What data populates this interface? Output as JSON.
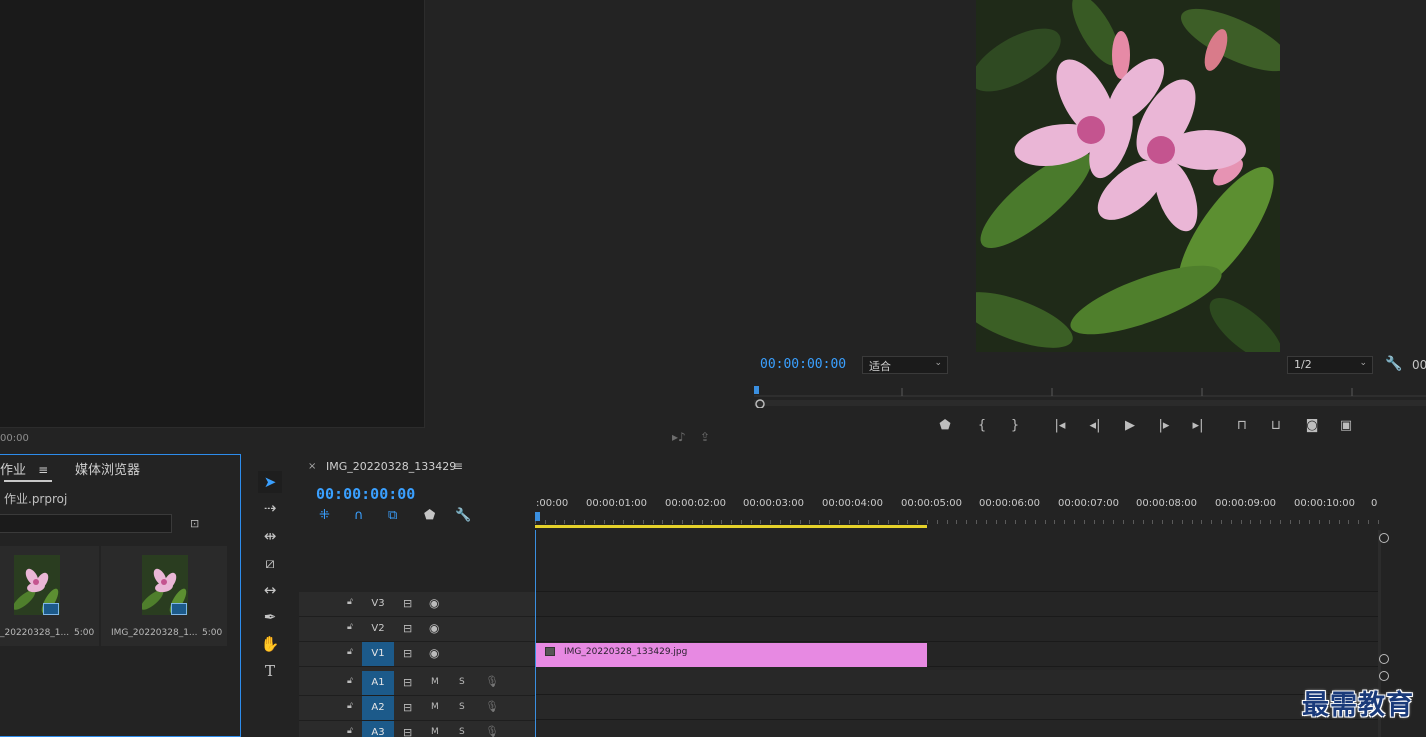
{
  "source_monitor": {
    "timecode_partial": "00:00",
    "icons": [
      "audio-only-icon",
      "export-icon"
    ]
  },
  "program_monitor": {
    "timecode": "00:00:00:00",
    "fit_dropdown": "适合",
    "resolution_dropdown": "1/2",
    "right_timecode_partial": "00",
    "controls": [
      "marker-icon",
      "mark-in-icon",
      "mark-out-icon",
      "go-to-in-icon",
      "step-back-icon",
      "play-icon",
      "step-forward-icon",
      "go-to-out-icon",
      "lift-icon",
      "extract-icon",
      "export-frame-icon",
      "compare-icon"
    ]
  },
  "project_panel": {
    "tab_active": "作业",
    "tab_other": "媒体浏览器",
    "project_file": "作业.prproj",
    "items": [
      {
        "name": "_20220328_1...",
        "duration": "5:00"
      },
      {
        "name": "IMG_20220328_1...",
        "duration": "5:00"
      }
    ]
  },
  "timeline": {
    "sequence_name": "IMG_20220328_133429",
    "timecode": "00:00:00:00",
    "ruler_labels": [
      ":00:00",
      "00:00:01:00",
      "00:00:02:00",
      "00:00:03:00",
      "00:00:04:00",
      "00:00:05:00",
      "00:00:06:00",
      "00:00:07:00",
      "00:00:08:00",
      "00:00:09:00",
      "00:00:10:00",
      "0"
    ],
    "video_tracks": [
      "V3",
      "V2",
      "V1"
    ],
    "audio_tracks": [
      "A1",
      "A2",
      "A3"
    ],
    "audio_mute": "M",
    "audio_solo": "S",
    "clip_name": "IMG_20220328_133429.jpg",
    "clip_color": "#e789e2"
  },
  "watermark": "最需教育",
  "colors": {
    "accent": "#3aa0ff",
    "work_area": "#e5d12a",
    "track_target": "#1c5a8a"
  }
}
